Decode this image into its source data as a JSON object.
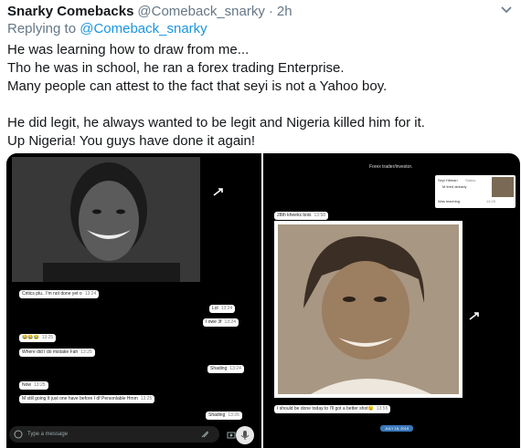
{
  "tweet": {
    "author_name": "Snarky Comebacks",
    "author_handle": "@Comeback_snarky",
    "separator": "·",
    "timestamp": "2h",
    "reply_prefix": "Replying to",
    "reply_to": "@Comeback_snarky",
    "caret_icon": "chevron-down-icon",
    "body_lines": [
      "He was learning how to draw from me...",
      "Tho he was in school, he ran a forex trading Enterprise.",
      "Many people can attest to the fact that seyi is not a Yahoo boy.",
      "He did legit, he always wanted to be legit and Nigeria killed him for it.",
      "Up Nigeria! You guys have done it again!"
    ]
  },
  "left_screenshot": {
    "messages": [
      {
        "text": "Critics plu.. I'm not done yet o",
        "time": "13:24"
      },
      {
        "text": "Lol",
        "time": "13:24"
      },
      {
        "text": "I owe 3f",
        "time": "13:24"
      },
      {
        "text": "😂😂😂",
        "time": "13:25"
      },
      {
        "text": "Where did I do mistake Fah",
        "time": "13:25"
      },
      {
        "text": "Shading",
        "time": "13:24"
      },
      {
        "text": "Now",
        "time": "13:25"
      },
      {
        "text": "M still going It just one have before I df Personlable Hmm",
        "time": "13:25"
      },
      {
        "text": "Shading",
        "time": "13:26"
      }
    ],
    "input_placeholder": "Type a message"
  },
  "right_screenshot": {
    "header_text": "Forex trader/investor.",
    "quote_name": "Seyi Hitman",
    "quote_sub": "Status",
    "quote_text": "M tired already",
    "quote_caption": "Was teaching",
    "quote_time": "14:25",
    "top_message": {
      "text": "28th kheeks bois",
      "time": "13:58"
    },
    "bottom_message": {
      "text": "I should be done today to I'll got a better shot😉",
      "time": "13:55"
    },
    "date_label": "JULY 18, 2019"
  }
}
